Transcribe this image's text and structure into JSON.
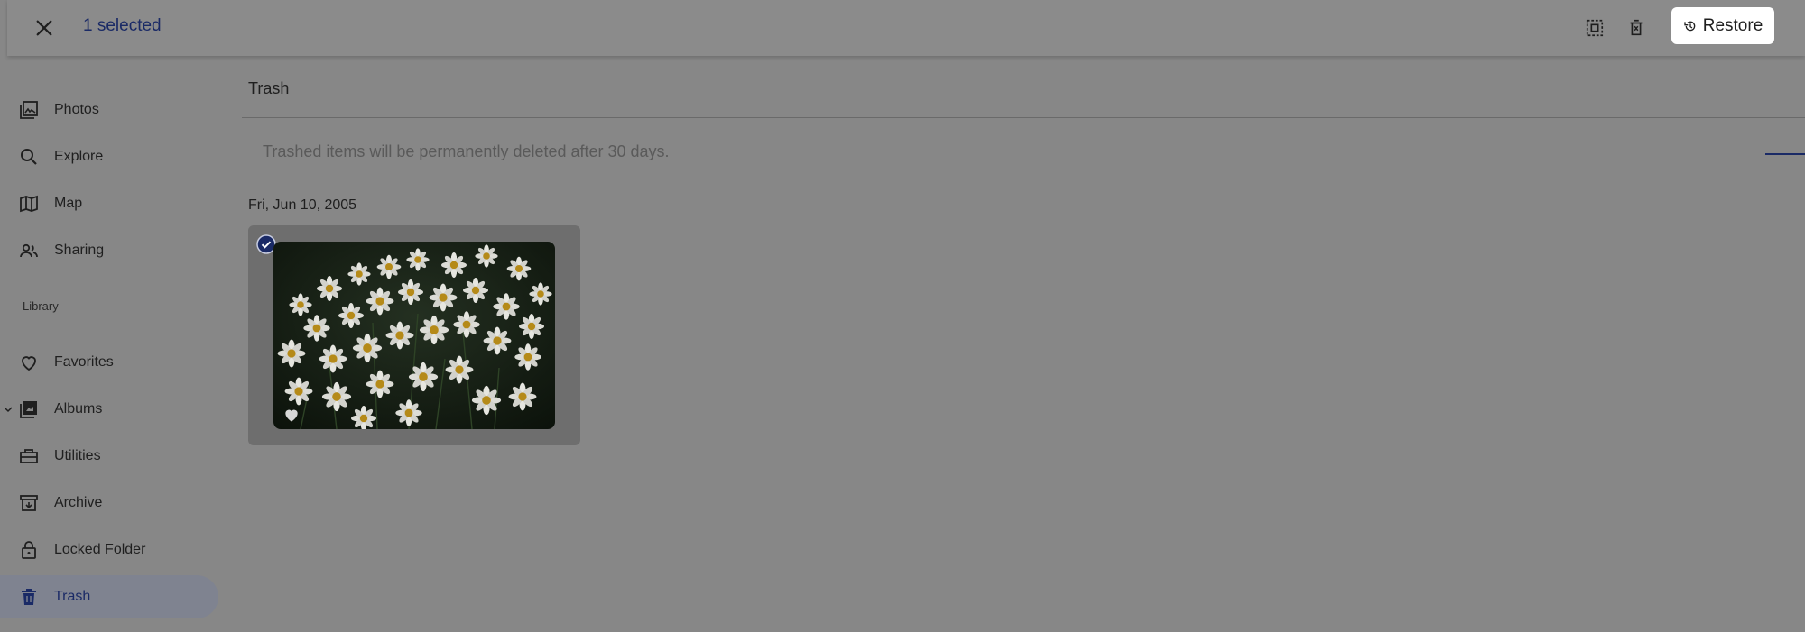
{
  "topbar": {
    "selected_text": "1 selected",
    "close_icon": "close-icon",
    "select_all_icon": "select-all-icon",
    "delete_icon": "delete-forever-icon",
    "restore_label": "Restore",
    "restore_icon": "restore-icon"
  },
  "sidebar": {
    "items": [
      {
        "label": "Photos",
        "icon": "photos-icon"
      },
      {
        "label": "Explore",
        "icon": "search-icon"
      },
      {
        "label": "Map",
        "icon": "map-icon"
      },
      {
        "label": "Sharing",
        "icon": "people-icon"
      }
    ],
    "section_label": "Library",
    "library_items": [
      {
        "label": "Favorites",
        "icon": "heart-icon"
      },
      {
        "label": "Albums",
        "icon": "albums-icon"
      },
      {
        "label": "Utilities",
        "icon": "utilities-icon"
      },
      {
        "label": "Archive",
        "icon": "archive-icon"
      },
      {
        "label": "Locked Folder",
        "icon": "lock-icon"
      },
      {
        "label": "Trash",
        "icon": "trash-icon",
        "active": true
      }
    ]
  },
  "main": {
    "title": "Trash",
    "notice": "Trashed items will be permanently deleted after 30 days.",
    "date_header": "Fri, Jun 10, 2005",
    "photo": {
      "selected": true,
      "favorite": true
    }
  },
  "colors": {
    "accent": "#1a2a66",
    "overlay_background": "#878787",
    "restore_background": "#ffffff"
  }
}
